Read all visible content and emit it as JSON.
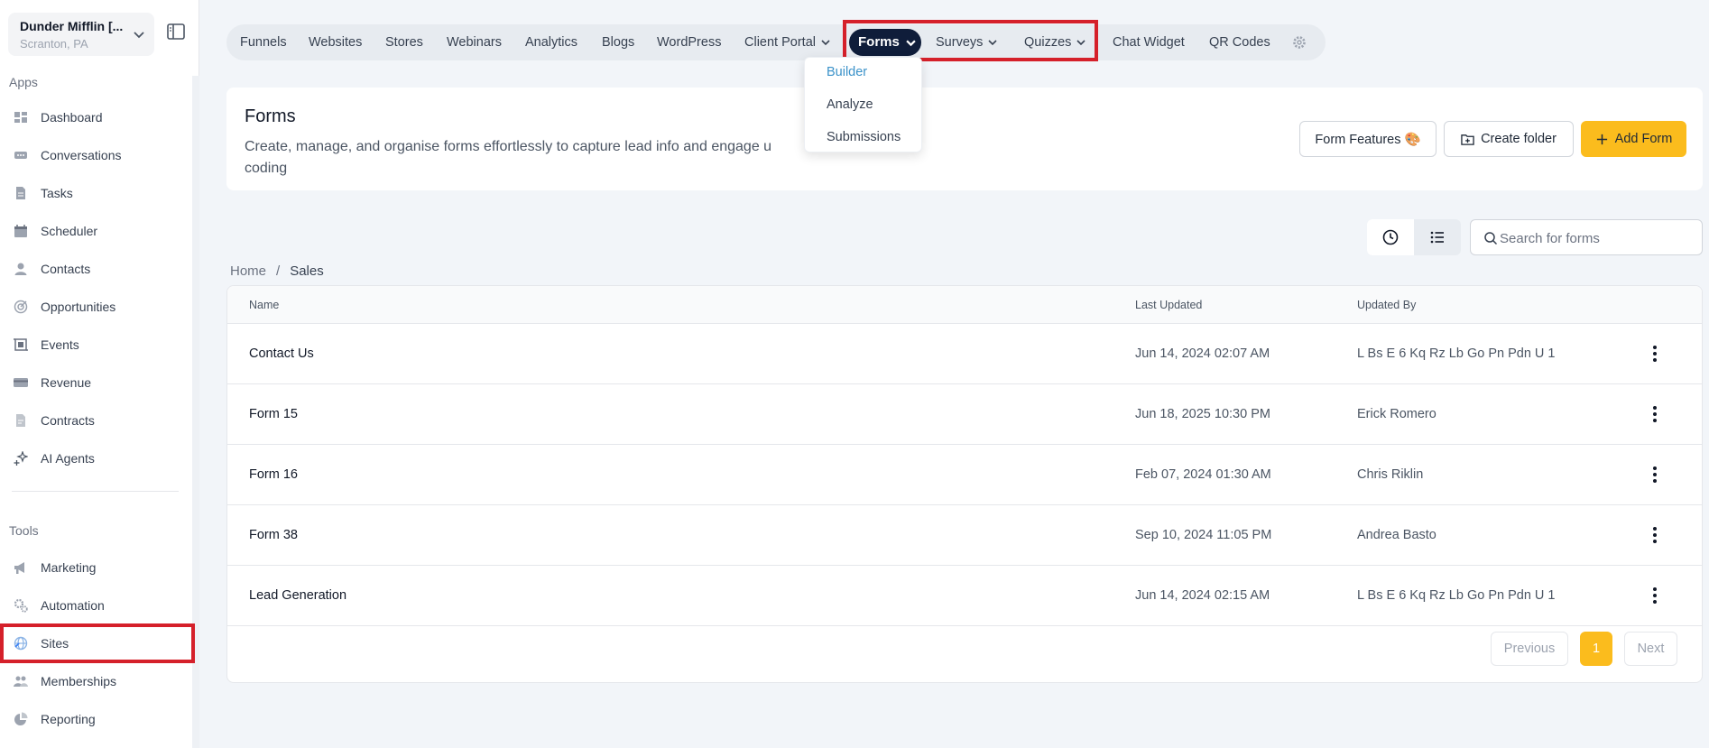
{
  "account": {
    "name": "Dunder Mifflin [...",
    "location": "Scranton, PA"
  },
  "sidebar": {
    "apps_label": "Apps",
    "tools_label": "Tools",
    "apps": [
      {
        "label": "Dashboard",
        "icon": "dashboard-icon"
      },
      {
        "label": "Conversations",
        "icon": "chat-icon"
      },
      {
        "label": "Tasks",
        "icon": "tasks-icon"
      },
      {
        "label": "Scheduler",
        "icon": "calendar-icon"
      },
      {
        "label": "Contacts",
        "icon": "user-icon"
      },
      {
        "label": "Opportunities",
        "icon": "target-icon"
      },
      {
        "label": "Events",
        "icon": "events-icon"
      },
      {
        "label": "Revenue",
        "icon": "card-icon"
      },
      {
        "label": "Contracts",
        "icon": "document-icon"
      },
      {
        "label": "AI Agents",
        "icon": "sparkle-icon"
      }
    ],
    "tools": [
      {
        "label": "Marketing",
        "icon": "megaphone-icon"
      },
      {
        "label": "Automation",
        "icon": "cogs-icon"
      },
      {
        "label": "Sites",
        "icon": "globe-icon"
      },
      {
        "label": "Memberships",
        "icon": "members-icon"
      },
      {
        "label": "Reporting",
        "icon": "pie-icon"
      }
    ]
  },
  "topnav": {
    "items": [
      "Funnels",
      "Websites",
      "Stores",
      "Webinars",
      "Analytics",
      "Blogs",
      "WordPress",
      "Client Portal",
      "Forms",
      "Surveys",
      "Quizzes",
      "Chat Widget",
      "QR Codes"
    ],
    "active": "Forms"
  },
  "forms_menu": {
    "items": [
      "Builder",
      "Analyze",
      "Submissions"
    ],
    "active": "Builder"
  },
  "header": {
    "title": "Forms",
    "description": "Create, manage, and organise forms effortlessly to capture lead info and engage u... coding",
    "description_line1": "Create, manage, and organise forms effortlessly to capture lead info and engage u",
    "description_line2": "coding",
    "features_label": "Form Features 🎨",
    "create_folder_label": "Create folder",
    "add_form_label": "Add Form"
  },
  "search": {
    "placeholder": "Search for forms"
  },
  "breadcrumb": {
    "home": "Home",
    "separator": "/",
    "current": "Sales"
  },
  "table": {
    "columns": [
      "Name",
      "Last Updated",
      "Updated By"
    ],
    "rows": [
      {
        "name": "Contact Us",
        "updated": "Jun 14, 2024 02:07 AM",
        "by": "L Bs E 6 Kq Rz Lb Go Pn Pdn U 1"
      },
      {
        "name": "Form 15",
        "updated": "Jun 18, 2025 10:30 PM",
        "by": "Erick Romero"
      },
      {
        "name": "Form 16",
        "updated": "Feb 07, 2024 01:30 AM",
        "by": "Chris Riklin"
      },
      {
        "name": "Form 38",
        "updated": "Sep 10, 2024 11:05 PM",
        "by": "Andrea Basto"
      },
      {
        "name": "Lead Generation",
        "updated": "Jun 14, 2024 02:15 AM",
        "by": "L Bs E 6 Kq Rz Lb Go Pn Pdn U 1"
      }
    ]
  },
  "pagination": {
    "previous": "Previous",
    "page": "1",
    "next": "Next"
  },
  "colors": {
    "accent": "#fbbc1d",
    "nav_active": "#0f1d3a",
    "highlight": "#d5202a",
    "link": "#3b92c9"
  }
}
